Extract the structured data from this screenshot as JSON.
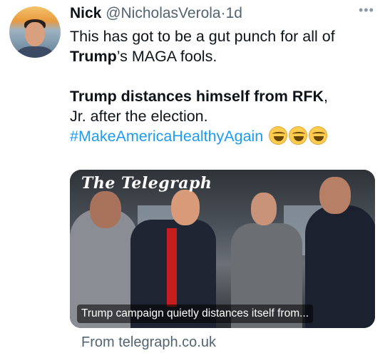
{
  "tweet": {
    "author_name": "Nick",
    "author_handle": "@NicholasVerola",
    "separator": "·",
    "time": "1d",
    "more_label": "•••",
    "line1": "This has got to be a gut punch for all of",
    "line2_bold": "Trump",
    "line2_rest": "’s MAGA fools.",
    "headline_bold": "Trump distances himself from RFK",
    "headline_comma": ",",
    "headline_rest": "Jr. after the election.",
    "hashtag": "#MakeAmericaHealthyAgain"
  },
  "card": {
    "logo_text": "The Telegraph",
    "caption": "Trump campaign quietly distances itself from...",
    "source": "From telegraph.co.uk"
  },
  "icons": {
    "avatar": "profile-photo",
    "emoji": "face-with-tears-of-joy",
    "more": "ellipsis-icon"
  }
}
